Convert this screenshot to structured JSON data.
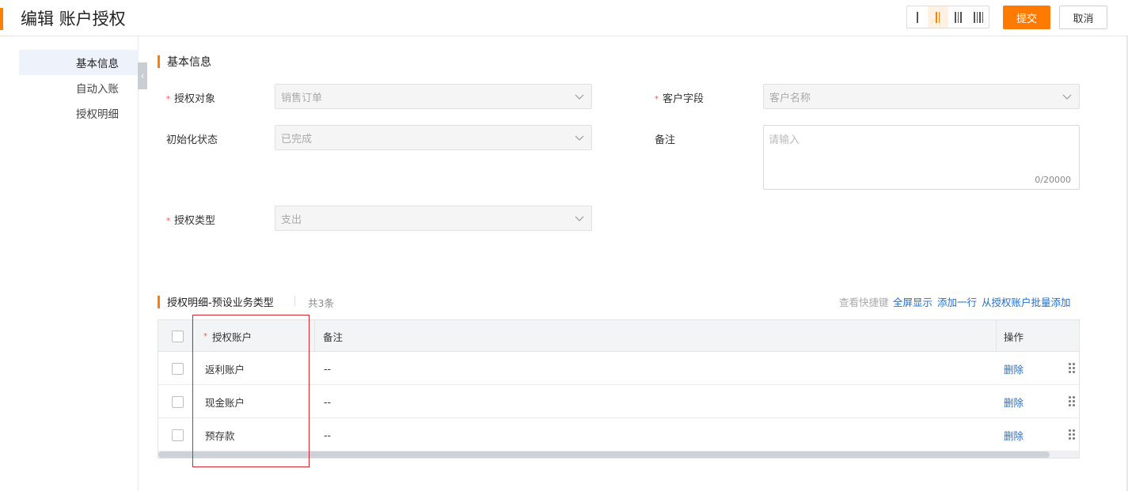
{
  "header": {
    "title": "编辑 账户授权",
    "submit_label": "提交",
    "cancel_label": "取消",
    "column_layout_options": [
      "1-column",
      "2-column",
      "3-column",
      "4-column"
    ],
    "column_layout_selected": "2-column"
  },
  "sidebar": {
    "items": [
      {
        "label": "基本信息",
        "active": true
      },
      {
        "label": "自动入账",
        "active": false
      },
      {
        "label": "授权明细",
        "active": false
      }
    ],
    "collapse_icon": "chevron-left-icon"
  },
  "basic_info": {
    "section_title": "基本信息",
    "fields": {
      "auth_object": {
        "label": "授权对象",
        "required": true,
        "value": "销售订单"
      },
      "customer_field": {
        "label": "客户字段",
        "required": true,
        "value": "客户名称"
      },
      "init_status": {
        "label": "初始化状态",
        "required": false,
        "value": "已完成"
      },
      "remark": {
        "label": "备注",
        "required": false,
        "placeholder": "请输入",
        "counter": "0/20000"
      },
      "auth_type": {
        "label": "授权类型",
        "required": true,
        "value": "支出"
      }
    }
  },
  "detail": {
    "section_title": "授权明细-预设业务类型",
    "count_text": "共3条",
    "actions": {
      "shortcuts": "查看快捷键",
      "fullscreen": "全屏显示",
      "add_row": "添加一行",
      "batch_add": "从授权账户批量添加"
    },
    "columns": {
      "account": "授权账户",
      "remark": "备注",
      "operation": "操作"
    },
    "rows": [
      {
        "account": "返利账户",
        "remark": "--",
        "action": "删除"
      },
      {
        "account": "现金账户",
        "remark": "--",
        "action": "删除"
      },
      {
        "account": "预存款",
        "remark": "--",
        "action": "删除"
      }
    ]
  },
  "colors": {
    "accent": "#ff8000",
    "link": "#1f6fd1",
    "required": "#ff4d4f",
    "highlight_box": "#d9262c"
  }
}
